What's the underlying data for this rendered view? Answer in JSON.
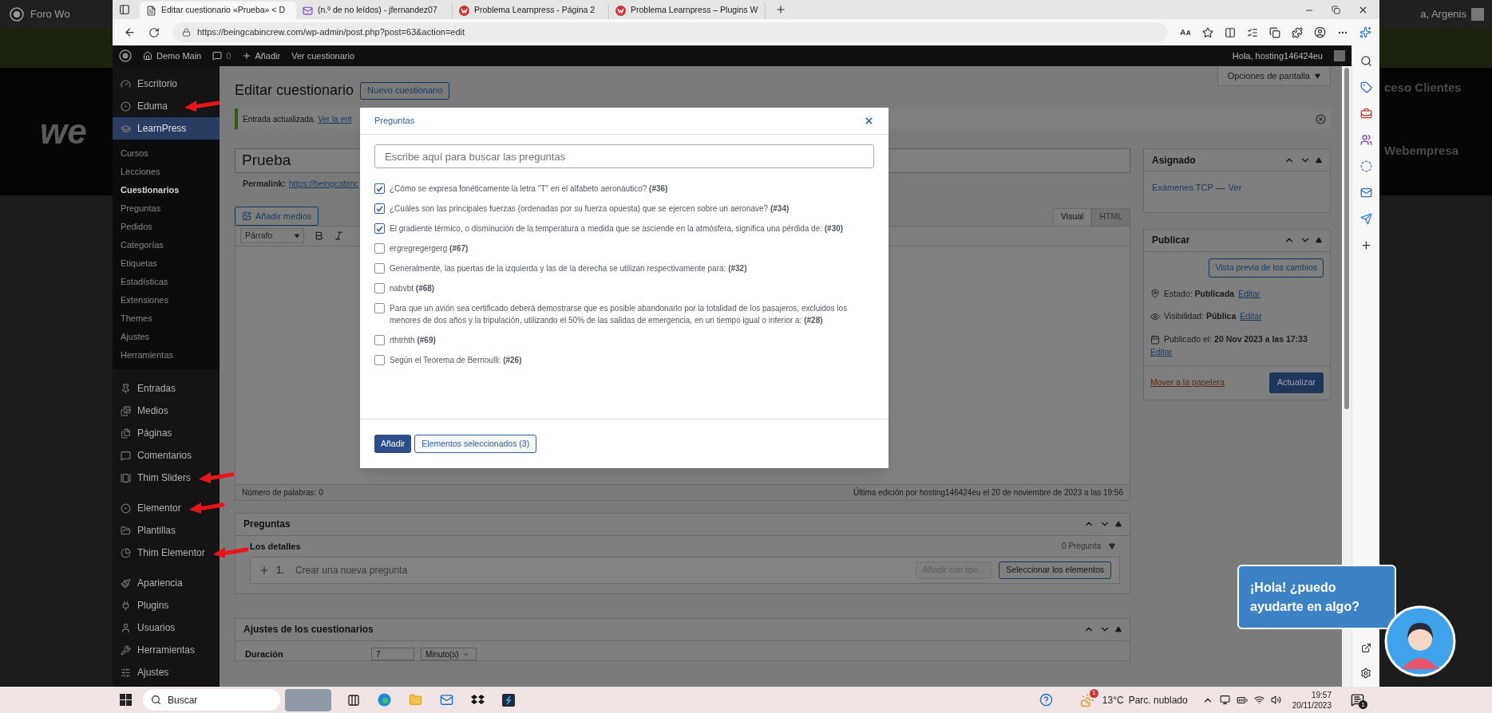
{
  "desktop": {
    "left_window_title": "Foro Wo",
    "left_logo": "we",
    "right_user": "a, Argenis",
    "right_texts": [
      "ceso Clientes",
      "Webempresa"
    ]
  },
  "browser": {
    "tabs": [
      {
        "kind": "page",
        "title": "Editar cuestionario «Prueba» < D",
        "selected": true
      },
      {
        "kind": "mail",
        "title": "(n.º de no leídos) - jfernandez07",
        "selected": false
      },
      {
        "kind": "forum",
        "title": "Problema Learnpress - Página 2",
        "selected": false
      },
      {
        "kind": "forum",
        "title": "Problema Learnpress – Plugins W",
        "selected": false
      }
    ],
    "url": "https://beingcabincrew.com/wp-admin/post.php?post=63&action=edit"
  },
  "admin_bar": {
    "site": "Demo Main",
    "comments": "0",
    "new": "Añadir",
    "view": "Ver cuestionario",
    "greeting": "Hola, hosting146424eu"
  },
  "sidebar": {
    "groups": [
      {
        "items": [
          {
            "label": "Escritorio",
            "selected": false,
            "marked": false
          },
          {
            "label": "Eduma",
            "selected": false,
            "marked": true
          },
          {
            "label": "LearnPress",
            "selected": true,
            "marked": false,
            "children": [
              {
                "label": "Cursos",
                "selected": false
              },
              {
                "label": "Lecciones",
                "selected": false
              },
              {
                "label": "Cuestionarios",
                "selected": true
              },
              {
                "label": "Preguntas",
                "selected": false
              },
              {
                "label": "Pedidos",
                "selected": false
              },
              {
                "label": "Categorías",
                "selected": false
              },
              {
                "label": "Etiquetas",
                "selected": false
              },
              {
                "label": "Estadísticas",
                "selected": false
              },
              {
                "label": "Extensiones",
                "selected": false
              },
              {
                "label": "Themes",
                "selected": false
              },
              {
                "label": "Ajustes",
                "selected": false
              },
              {
                "label": "Herramientas",
                "selected": false
              }
            ]
          }
        ]
      },
      {
        "items": [
          {
            "label": "Entradas",
            "selected": false,
            "marked": false
          },
          {
            "label": "Medios",
            "selected": false,
            "marked": false
          },
          {
            "label": "Páginas",
            "selected": false,
            "marked": false
          },
          {
            "label": "Comentarios",
            "selected": false,
            "marked": false
          },
          {
            "label": "Thim Sliders",
            "selected": false,
            "marked": true
          }
        ]
      },
      {
        "items": [
          {
            "label": "Elementor",
            "selected": false,
            "marked": true
          },
          {
            "label": "Plantillas",
            "selected": false,
            "marked": false
          },
          {
            "label": "Thim Elementor",
            "selected": false,
            "marked": true
          }
        ]
      },
      {
        "items": [
          {
            "label": "Apariencia",
            "selected": false,
            "marked": false
          },
          {
            "label": "Plugins",
            "selected": false,
            "marked": false
          },
          {
            "label": "Usuarios",
            "selected": false,
            "marked": false
          },
          {
            "label": "Herramientas",
            "selected": false,
            "marked": false
          },
          {
            "label": "Ajustes",
            "selected": false,
            "marked": false
          }
        ]
      }
    ]
  },
  "page": {
    "title": "Editar cuestionario",
    "new_button": "Nuevo cuestionario",
    "screen_options": "Opciones de pantalla",
    "notice": {
      "text": "Entrada actualizada.",
      "link": "Ver la ent"
    },
    "post_title": "Prueba",
    "permalink_label": "Permalink:",
    "permalink": "https://beingcabinc",
    "media_button": "Añadir medios",
    "format": "Párrafo",
    "editor_tabs": [
      {
        "label": "Visual",
        "selected": true
      },
      {
        "label": "HTML",
        "selected": false
      }
    ],
    "word_count": "Número de palabras: 0",
    "last_edit": "Última edición por hosting146424eu el 20 de noviembre de 2023 a las 19:56"
  },
  "questions_box": {
    "title": "Preguntas",
    "details": "Los detalles",
    "count": "0 Pregunta",
    "row_number": "1.",
    "new_placeholder": "Crear una nueva pregunta",
    "add_type": {
      "label": "Añadir con tipo...",
      "disabled": true
    },
    "select": "Seleccionar los elementos"
  },
  "settings_box": {
    "title": "Ajustes de los cuestionarios",
    "duration_label": "Duración",
    "duration_value": "7",
    "duration_unit": "Minuto(s)"
  },
  "assigned": {
    "title": "Asignado",
    "course": "Exámenes TCP",
    "separator": "—",
    "view": "Ver"
  },
  "publish": {
    "title": "Publicar",
    "preview": "Vista previa de los cambios",
    "rows": [
      {
        "kind": "status",
        "text": "Estado: **Publicada**",
        "link": "Editar"
      },
      {
        "kind": "visibility",
        "text": "Visibilidad: **Pública**",
        "link": "Editar"
      },
      {
        "kind": "date",
        "text": "Publicado el: **20 Nov 2023 a las 17:33**",
        "link": "Editar"
      }
    ],
    "trash": "Mover a la papelera",
    "update": "Actualizar"
  },
  "modal": {
    "tab": "Preguntas",
    "search_placeholder": "Escribe aquí para buscar las preguntas",
    "items": [
      {
        "text": "¿Cómo se expresa fonéticamente la letra \"T\" en el alfabeto aeronáutico? **(#36)**",
        "checked": true
      },
      {
        "text": "¿Cuáles son las principales fuerzas (ordenadas por su fuerza opuesta) que se ejercen sobre un aeronave? **(#34)**",
        "checked": true
      },
      {
        "text": "El gradiente térmico, o disminución de la temperatura a medida que se asciende en la atmósfera, significa una pérdida de: **(#30)**",
        "checked": true
      },
      {
        "text": "ergregregergerg **(#67)**",
        "checked": false
      },
      {
        "text": "Generalmente, las puertas de la izquierda y las de la derecha se utilizan respectivamente para: **(#32)**",
        "checked": false
      },
      {
        "text": "nabvbt **(#68)**",
        "checked": false
      },
      {
        "text": "Para que un avión sea certificado deberá demostrarse que es posible abandonarlo por la totalidad de los pasajeros, excluidos los menores de dos años y la tripulación, utilizando el 50% de las salidas de emergencia, en un tiempo igual o inferior a: **(#28)**",
        "checked": false
      },
      {
        "text": "rthtrhth **(#69)**",
        "checked": false
      },
      {
        "text": "Según el Teorema de Bernoulli: **(#26)**",
        "checked": false
      }
    ],
    "add": "Añadir",
    "selected_button": "Elementos seleccionados (3)"
  },
  "chat": {
    "message": "¡Hola! ¿puedo ayudarte en algo?"
  },
  "taskbar": {
    "search": "Buscar",
    "weather_badge": "1",
    "temperature": "13°C",
    "weather": "Parc. nublado",
    "time": "19:57",
    "date": "20/11/2023",
    "notifications": "1"
  }
}
